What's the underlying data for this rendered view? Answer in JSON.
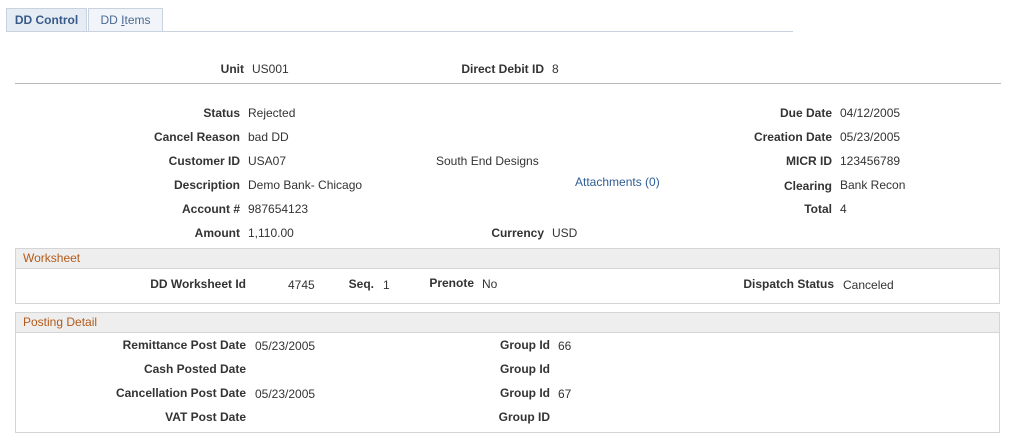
{
  "tabs": {
    "control": "DD Control",
    "items_prefix": "DD ",
    "items_hotkey": "I",
    "items_suffix": "tems"
  },
  "header": {
    "unit_label": "Unit",
    "unit_value": "US001",
    "ddid_label": "Direct Debit ID",
    "ddid_value": "8"
  },
  "details": {
    "status_label": "Status",
    "status_value": "Rejected",
    "cancel_label": "Cancel Reason",
    "cancel_value": "bad DD",
    "customer_label": "Customer ID",
    "customer_value": "USA07",
    "customer_name": "South End Designs",
    "desc_label": "Description",
    "desc_value": "Demo Bank- Chicago",
    "account_label": "Account #",
    "account_value": "987654123",
    "amount_label": "Amount",
    "amount_value": "1,110.00",
    "currency_label": "Currency",
    "currency_value": "USD",
    "attachments": "Attachments (0)",
    "due_label": "Due Date",
    "due_value": "04/12/2005",
    "creation_label": "Creation Date",
    "creation_value": "05/23/2005",
    "micr_label": "MICR ID",
    "micr_value": "123456789",
    "clearing_label": "Clearing",
    "clearing_value": "Bank Recon",
    "total_label": "Total",
    "total_value": "4"
  },
  "worksheet": {
    "title": "Worksheet",
    "id_label": "DD Worksheet Id",
    "id_value": "4745",
    "seq_label": "Seq.",
    "seq_value": "1",
    "prenote_label": "Prenote",
    "prenote_value": "No",
    "dispatch_label": "Dispatch Status",
    "dispatch_value": "Canceled"
  },
  "posting": {
    "title": "Posting Detail",
    "remit_label": "Remittance Post Date",
    "remit_value": "05/23/2005",
    "remit_group_label": "Group Id",
    "remit_group_value": "66",
    "cash_label": "Cash Posted Date",
    "cash_value": "",
    "cash_group_label": "Group Id",
    "cash_group_value": "",
    "cancel_label": "Cancellation Post Date",
    "cancel_value": "05/23/2005",
    "cancel_group_label": "Group Id",
    "cancel_group_value": "67",
    "vat_label": "VAT Post Date",
    "vat_value": "",
    "vat_group_label": "Group ID",
    "vat_group_value": ""
  }
}
